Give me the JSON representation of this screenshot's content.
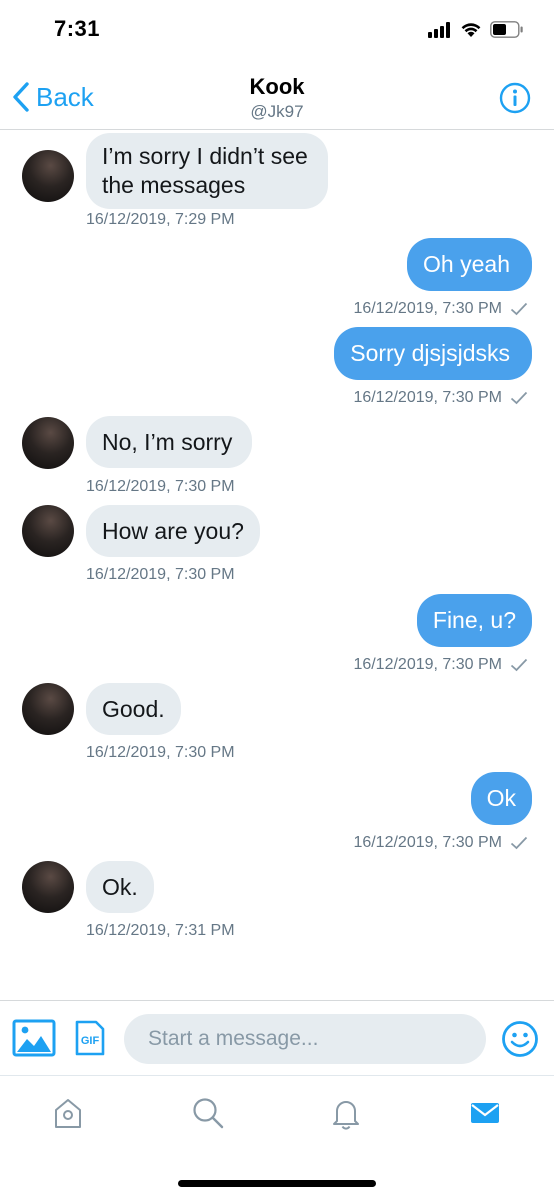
{
  "status_bar": {
    "time": "7:31"
  },
  "header": {
    "back_label": "Back",
    "title": "Kook",
    "handle": "@Jk97"
  },
  "messages": [
    {
      "direction": "in",
      "text_lines": [
        "I’m sorry I didn’t see",
        "the messages"
      ],
      "timestamp": "16/12/2019, 7:29 PM"
    },
    {
      "direction": "out",
      "text": "Oh yeah",
      "timestamp": "16/12/2019, 7:30 PM",
      "read": true
    },
    {
      "direction": "out",
      "text": "Sorry djsjsjdsks",
      "timestamp": "16/12/2019, 7:30 PM",
      "read": true
    },
    {
      "direction": "in",
      "text": "No, I’m sorry",
      "timestamp": "16/12/2019, 7:30 PM"
    },
    {
      "direction": "in",
      "text": "How are you?",
      "timestamp": "16/12/2019, 7:30 PM"
    },
    {
      "direction": "out",
      "text": "Fine, u?",
      "timestamp": "16/12/2019, 7:30 PM",
      "read": true
    },
    {
      "direction": "in",
      "text": "Good.",
      "timestamp": "16/12/2019, 7:30 PM"
    },
    {
      "direction": "out",
      "text": "Ok",
      "timestamp": "16/12/2019, 7:30 PM",
      "read": true
    },
    {
      "direction": "in",
      "text": "Ok.",
      "timestamp": "16/12/2019, 7:31 PM"
    }
  ],
  "composer": {
    "placeholder": "Start a message...",
    "gif_label": "GIF"
  },
  "tabbar": {
    "items": [
      "home-icon",
      "search-icon",
      "notifications-icon",
      "messages-icon"
    ],
    "active": "messages-icon"
  },
  "colors": {
    "accent": "#1da1f2",
    "outgoing_bubble": "#4aa1ec",
    "incoming_bubble": "#e6ecf0",
    "secondary_text": "#657786"
  }
}
